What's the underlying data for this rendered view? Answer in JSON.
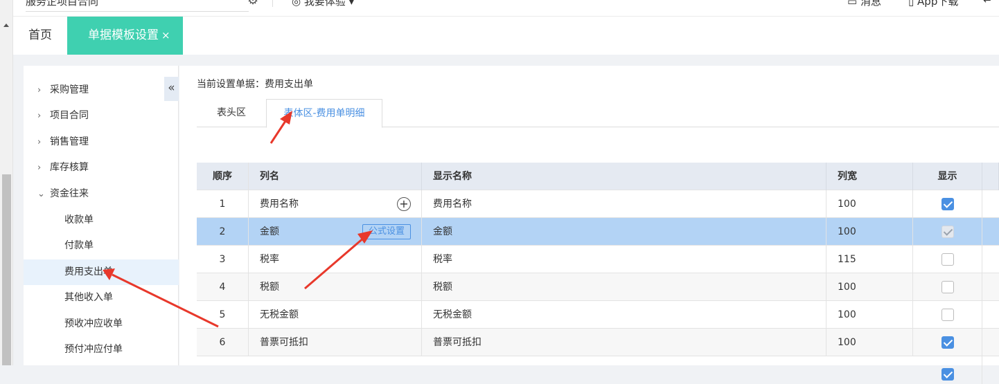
{
  "topbar": {
    "company": "服务企项目合同",
    "experience": "我要体验",
    "messages": "消息",
    "app_download": "App下载"
  },
  "tabs": {
    "home": "首页",
    "active": "单据模板设置",
    "close": "×"
  },
  "sidebar": {
    "collapse": "«",
    "groups": [
      {
        "label": "采购管理",
        "expanded": false
      },
      {
        "label": "项目合同",
        "expanded": false
      },
      {
        "label": "销售管理",
        "expanded": false
      },
      {
        "label": "库存核算",
        "expanded": false
      },
      {
        "label": "资金往来",
        "expanded": true
      }
    ],
    "sub_items": [
      "收款单",
      "付款单",
      "费用支出单",
      "其他收入单",
      "预收冲应收单",
      "预付冲应付单"
    ],
    "active_sub": "费用支出单"
  },
  "main": {
    "current_doc": "当前设置单据：费用支出单",
    "subtabs": [
      "表头区",
      "表体区-费用单明细"
    ],
    "active_subtab": 1
  },
  "table": {
    "headers": [
      "顺序",
      "列名",
      "显示名称",
      "列宽",
      "显示"
    ],
    "rows": [
      {
        "seq": "1",
        "col": "费用名称",
        "disp": "费用名称",
        "width": "100",
        "show": "checked"
      },
      {
        "seq": "2",
        "col": "金额",
        "disp": "金额",
        "width": "100",
        "show": "disabled",
        "action": "公式设置"
      },
      {
        "seq": "3",
        "col": "税率",
        "disp": "税率",
        "width": "115",
        "show": "unchecked"
      },
      {
        "seq": "4",
        "col": "税额",
        "disp": "税额",
        "width": "100",
        "show": "unchecked"
      },
      {
        "seq": "5",
        "col": "无税金额",
        "disp": "无税金额",
        "width": "100",
        "show": "unchecked"
      },
      {
        "seq": "6",
        "col": "普票可抵扣",
        "disp": "普票可抵扣",
        "width": "100",
        "show": "checked"
      }
    ]
  },
  "colors": {
    "accent_tab": "#3fd0b0",
    "link_blue": "#4a90e2",
    "selected_row": "#b3d3f5",
    "arrow_red": "#e8382b"
  }
}
